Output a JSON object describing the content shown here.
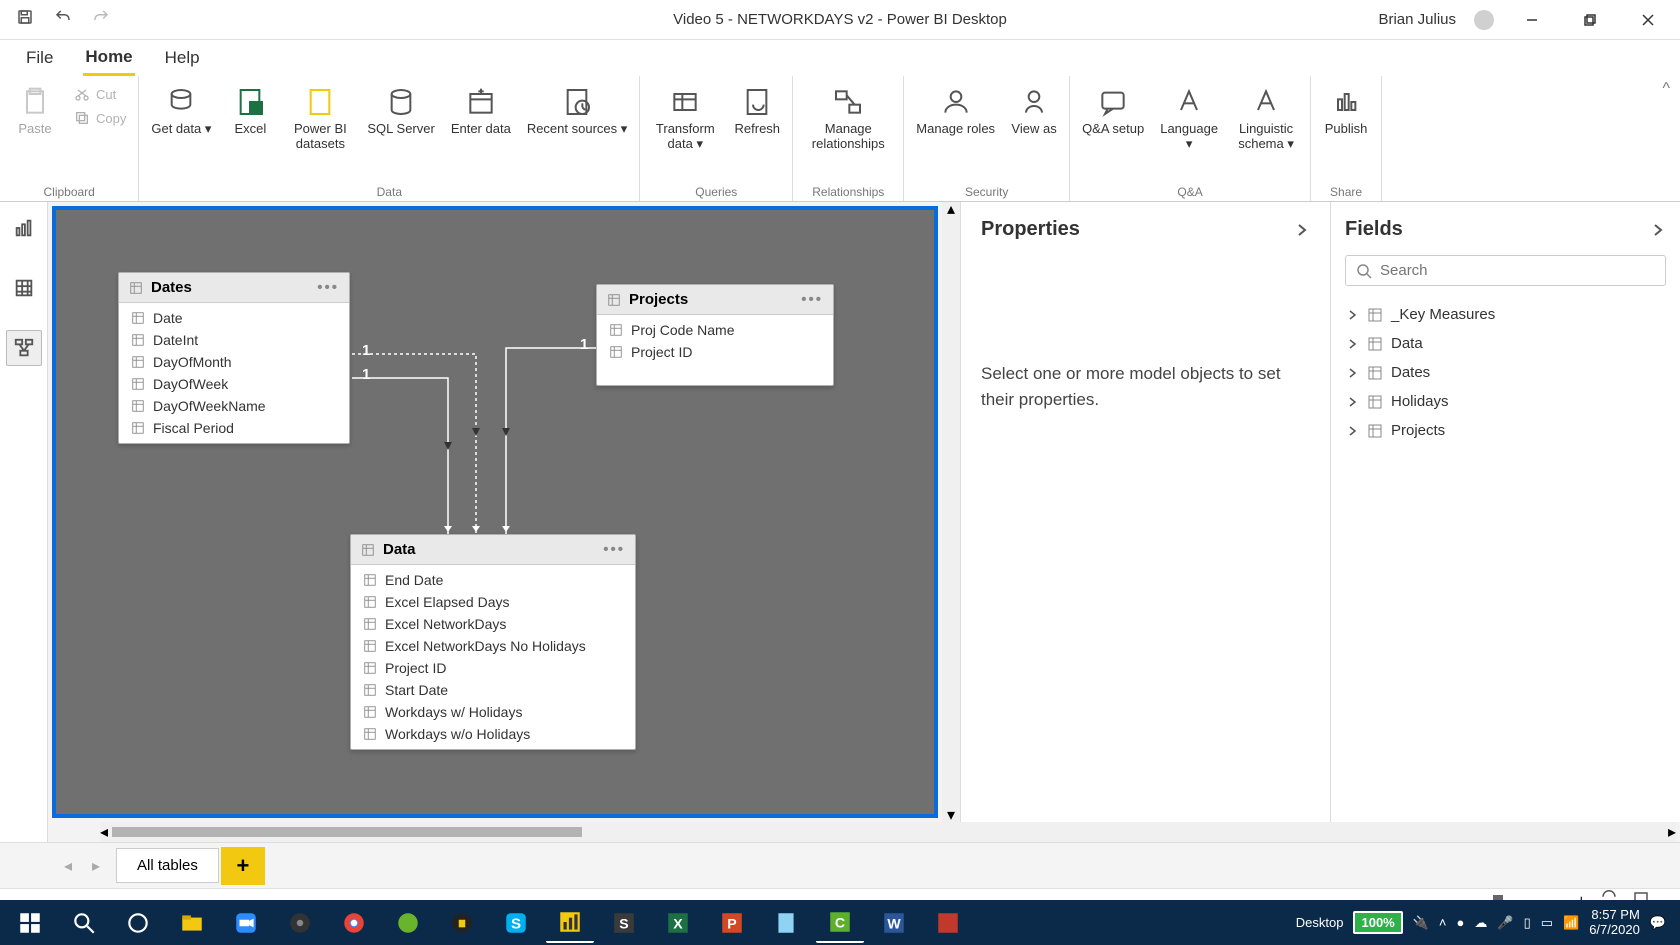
{
  "titlebar": {
    "title": "Video 5 - NETWORKDAYS v2 - Power BI Desktop",
    "username": "Brian Julius"
  },
  "menubar": {
    "file": "File",
    "home": "Home",
    "help": "Help"
  },
  "ribbon": {
    "clipboard": {
      "label": "Clipboard",
      "paste": "Paste",
      "cut": "Cut",
      "copy": "Copy"
    },
    "data": {
      "label": "Data",
      "get": "Get data",
      "excel": "Excel",
      "pbids": "Power BI datasets",
      "sql": "SQL Server",
      "enter": "Enter data",
      "recent": "Recent sources"
    },
    "queries": {
      "label": "Queries",
      "transform": "Transform data",
      "refresh": "Refresh"
    },
    "rel": {
      "label": "Relationships",
      "manage": "Manage relationships"
    },
    "security": {
      "label": "Security",
      "roles": "Manage roles",
      "viewas": "View as"
    },
    "qna": {
      "label": "Q&A",
      "setup": "Q&A setup",
      "lang": "Language",
      "ling": "Linguistic schema"
    },
    "share": {
      "label": "Share",
      "publish": "Publish"
    }
  },
  "canvas": {
    "tables": {
      "dates": {
        "name": "Dates",
        "fields": [
          "Date",
          "DateInt",
          "DayOfMonth",
          "DayOfWeek",
          "DayOfWeekName",
          "Fiscal Period"
        ]
      },
      "projects": {
        "name": "Projects",
        "fields": [
          "Proj Code Name",
          "Project ID"
        ]
      },
      "data": {
        "name": "Data",
        "fields": [
          "End Date",
          "Excel Elapsed Days",
          "Excel NetworkDays",
          "Excel NetworkDays No Holidays",
          "Project ID",
          "Start Date",
          "Workdays w/ Holidays",
          "Workdays w/o Holidays"
        ]
      }
    },
    "rel_labels": {
      "one_a": "1",
      "one_b": "1",
      "one_c": "1"
    }
  },
  "properties": {
    "title": "Properties",
    "body": "Select one or more model objects to set their properties."
  },
  "fields_panel": {
    "title": "Fields",
    "search_ph": "Search",
    "tables": [
      "_Key Measures",
      "Data",
      "Dates",
      "Holidays",
      "Projects"
    ]
  },
  "bottom": {
    "all_tables": "All tables"
  },
  "taskbar": {
    "desktop": "Desktop",
    "battery": "100%",
    "time": "8:57 PM",
    "date": "6/7/2020"
  }
}
